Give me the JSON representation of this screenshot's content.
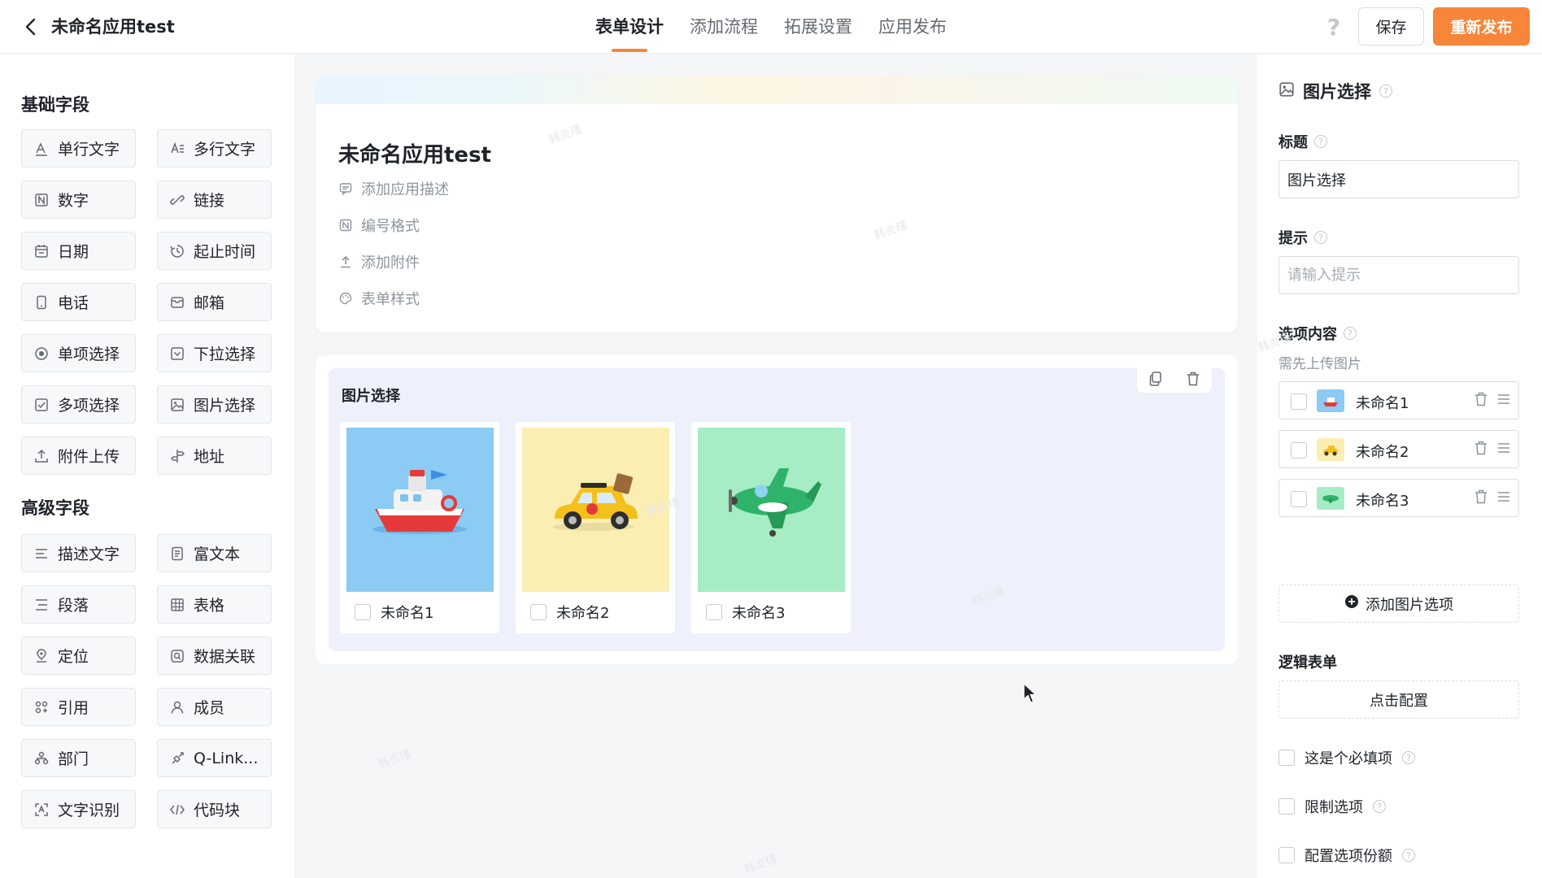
{
  "header": {
    "app_title": "未命名应用test",
    "tabs": [
      "表单设计",
      "添加流程",
      "拓展设置",
      "应用发布"
    ],
    "help_glyph": "?",
    "save_label": "保存",
    "publish_label": "重新发布"
  },
  "left": {
    "basic_title": "基础字段",
    "basic_fields": [
      "单行文字",
      "多行文字",
      "数字",
      "链接",
      "日期",
      "起止时间",
      "电话",
      "邮箱",
      "单项选择",
      "下拉选择",
      "多项选择",
      "图片选择",
      "附件上传",
      "地址"
    ],
    "advanced_title": "高级字段",
    "advanced_fields": [
      "描述文字",
      "富文本",
      "段落",
      "表格",
      "定位",
      "数据关联",
      "引用",
      "成员",
      "部门",
      "Q-Link...",
      "文字识别",
      "代码块"
    ]
  },
  "canvas": {
    "form_title": "未命名应用test",
    "meta": [
      "添加应用描述",
      "编号格式",
      "添加附件",
      "表单样式"
    ],
    "field_label": "图片选择",
    "pictures": [
      {
        "name": "未命名1",
        "bg": "#8ccbf3"
      },
      {
        "name": "未命名2",
        "bg": "#fbeeb3"
      },
      {
        "name": "未命名3",
        "bg": "#a6ecc4"
      }
    ],
    "watermark": "韩炎瑾"
  },
  "right": {
    "panel_title": "图片选择",
    "title_label": "标题",
    "title_value": "图片选择",
    "hint_label": "提示",
    "hint_placeholder": "请输入提示",
    "options_label": "选项内容",
    "options_sub": "需先上传图片",
    "options": [
      "未命名1",
      "未命名2",
      "未命名3"
    ],
    "add_option": "添加图片选项",
    "logic_label": "逻辑表单",
    "logic_button": "点击配置",
    "checks": [
      "这是个必填项",
      "限制选项",
      "配置选项份额"
    ]
  },
  "colors": {
    "accent": "#f7853a",
    "text": "#1f2329",
    "muted": "#8f959e"
  }
}
